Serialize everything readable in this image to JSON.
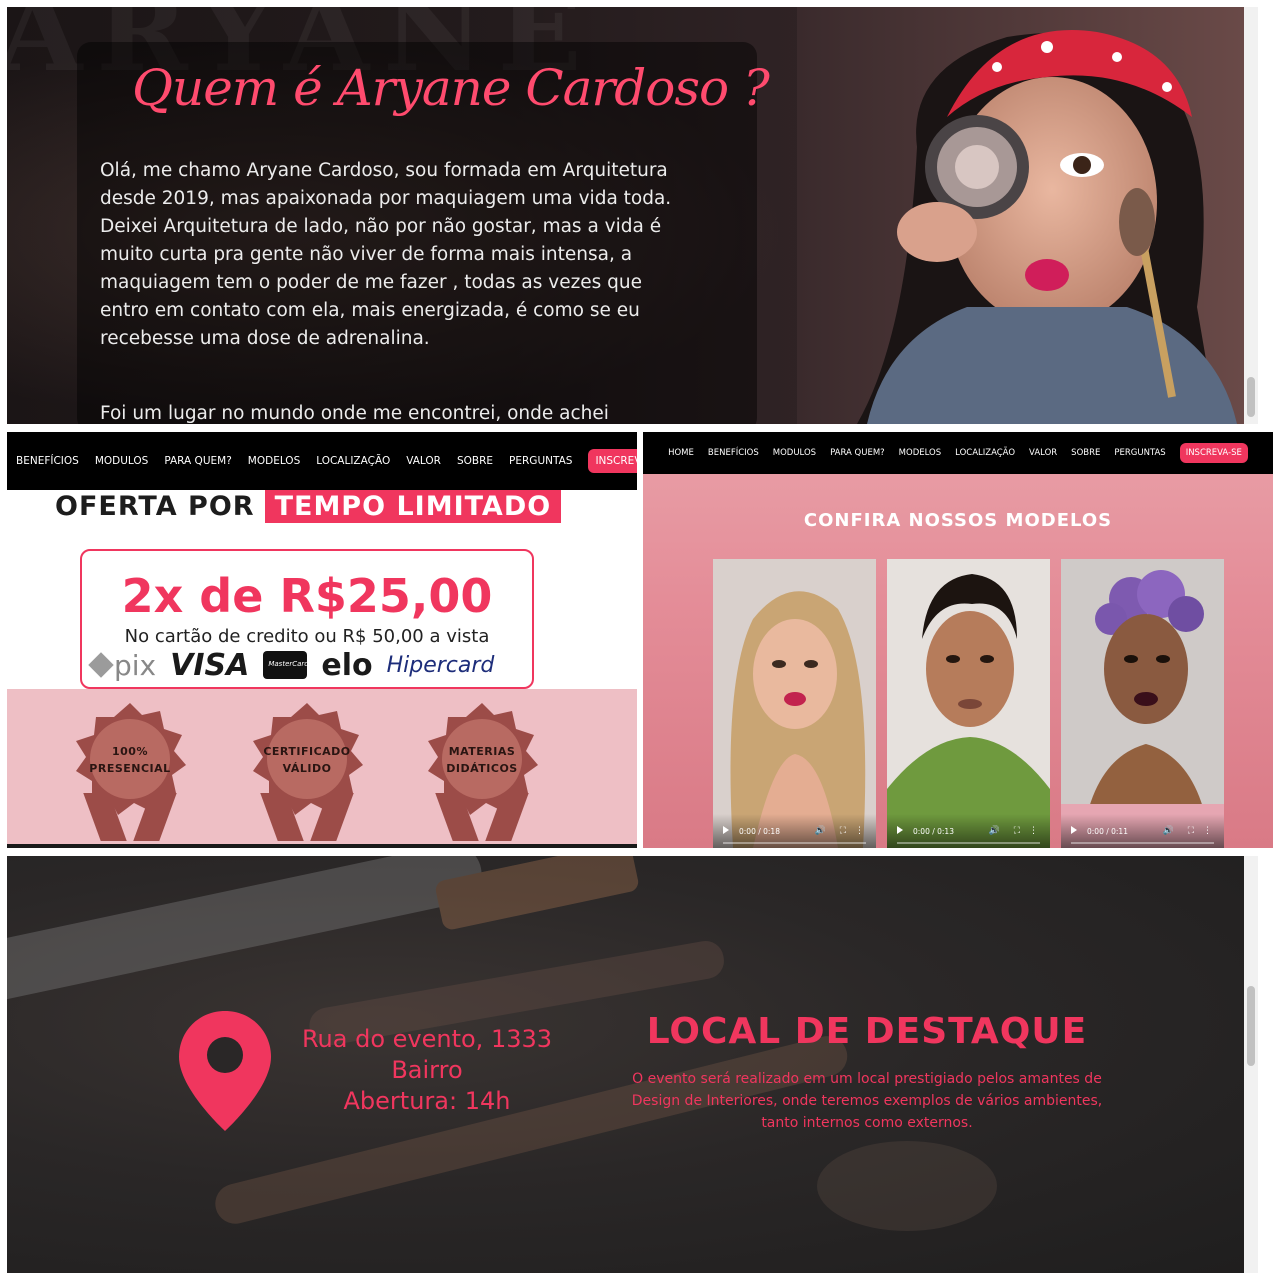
{
  "about": {
    "title": "Quem é Aryane Cardoso ?",
    "bio": "Olá, me chamo Aryane Cardoso, sou formada em Arquitetura desde 2019, mas apaixonada por maquiagem uma vida toda. Deixei Arquitetura de lado, não por não gostar, mas a vida é muito curta pra gente não viver de forma mais intensa, a maquiagem tem o poder de me fazer , todas as vezes que entro em contato com ela, mais energizada, é como se eu recebesse uma dose de adrenalina.",
    "bio_continued": "Foi um lugar no mundo onde me encontrei, onde achei"
  },
  "nav": {
    "home": "HOME",
    "beneficios": "BENEFÍCIOS",
    "modulos": "MODULOS",
    "para_quem": "PARA QUEM?",
    "modelos": "MODELOS",
    "localizacao": "LOCALIZAÇÃO",
    "valor": "VALOR",
    "sobre": "SOBRE",
    "perguntas": "PERGUNTAS",
    "inscreva_se": "INSCREVA-SE",
    "inscreva_truncated": "INSCREVA-S"
  },
  "offer": {
    "heading_plain": "OFERTA POR",
    "heading_highlight": "TEMPO LIMITADO",
    "price": "2x de R$25,00",
    "price_note": "No cartão de credito ou R$ 50,00 a vista",
    "payment_methods": [
      "pix",
      "VISA",
      "MasterCard",
      "elo",
      "Hipercard"
    ]
  },
  "badges": [
    {
      "line1": "100%",
      "line2": "PRESENCIAL"
    },
    {
      "line1": "CERTIFICADO",
      "line2": "VÁLIDO"
    },
    {
      "line1": "MATERIAS",
      "line2": "DIDÁTICOS"
    }
  ],
  "models": {
    "title": "CONFIRA NOSSOS MODELOS",
    "videos": [
      {
        "time": "0:00 / 0:18"
      },
      {
        "time": "0:00 / 0:13"
      },
      {
        "time": "0:00 / 0:11"
      }
    ]
  },
  "location": {
    "address_line1": "Rua do evento, 1333",
    "address_line2": "Bairro",
    "address_line3": "Abertura: 14h",
    "title": "LOCAL DE DESTAQUE",
    "description": "O evento será realizado em um local prestigiado pelos amantes de Design de Interiores, onde teremos exemplos de vários ambientes, tanto internos como externos."
  },
  "colors": {
    "accent": "#f0365e",
    "badge_bg": "#eebfc5",
    "seal": "#9c4c48"
  }
}
